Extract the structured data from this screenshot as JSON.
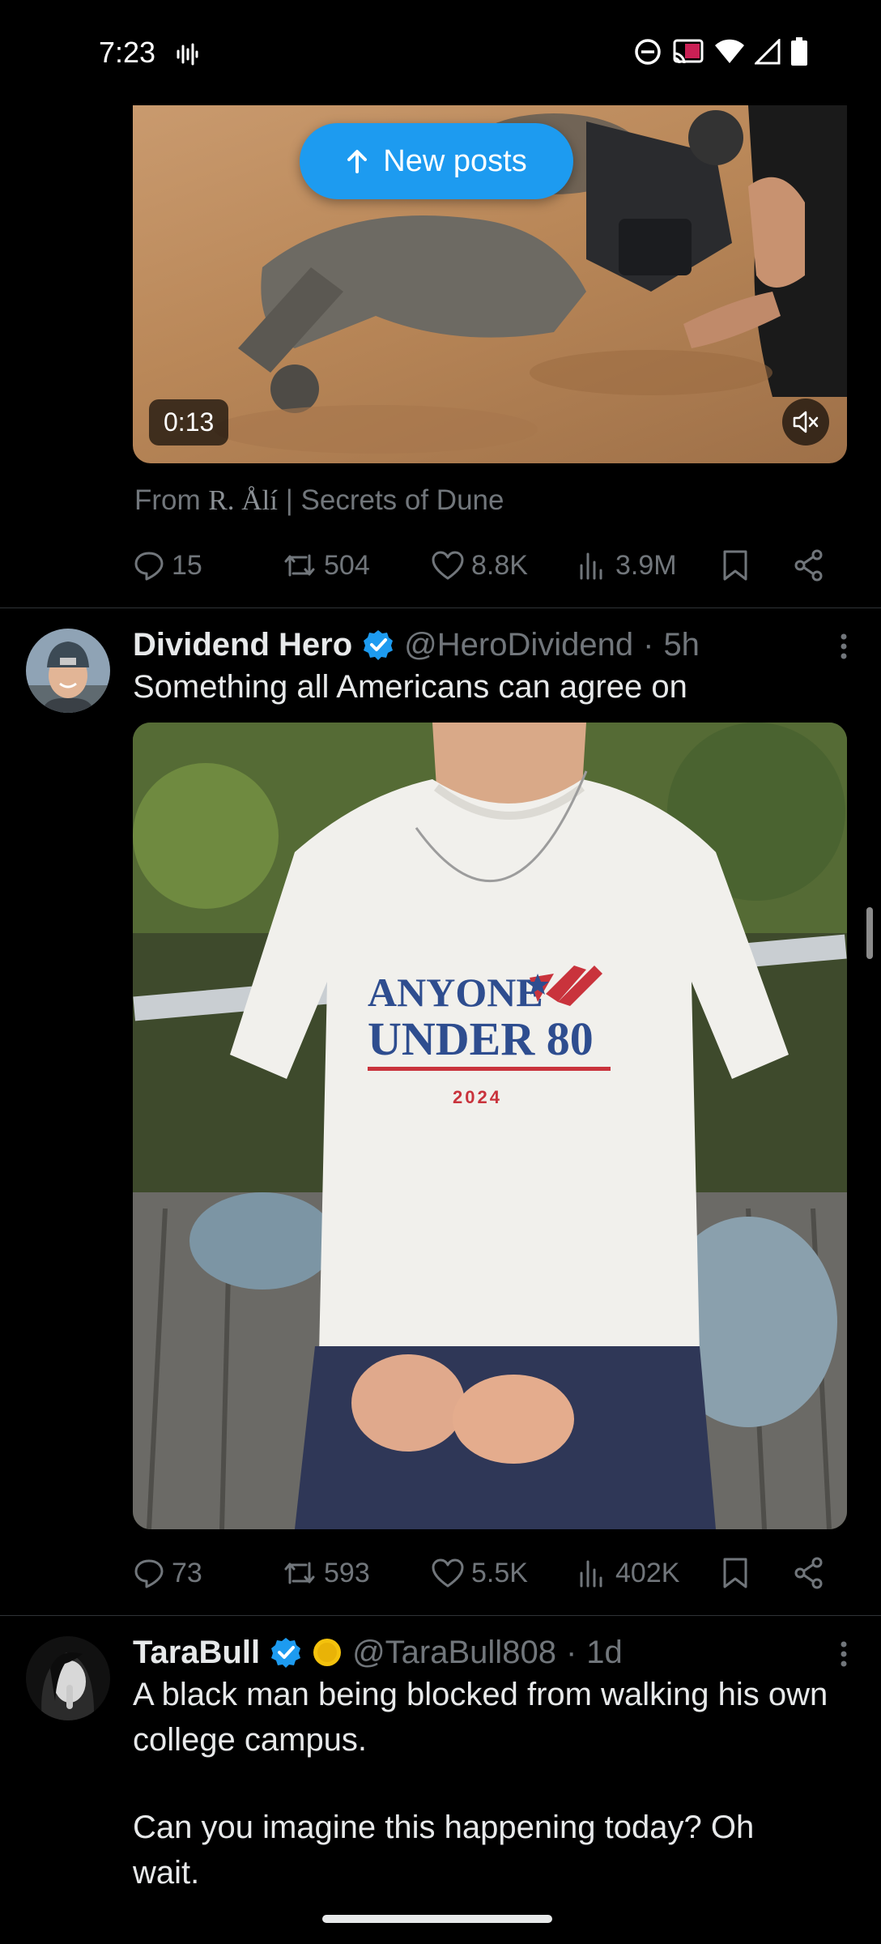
{
  "status_bar": {
    "time": "7:23"
  },
  "new_posts": {
    "label": "New posts"
  },
  "video_post": {
    "duration": "0:13",
    "source_prefix": "From",
    "source_name": "R. Ålí",
    "source_suffix": "| Secrets of Dune",
    "replies": "15",
    "reposts": "504",
    "likes": "8.8K",
    "views": "3.9M"
  },
  "post1": {
    "display_name": "Dividend Hero",
    "handle": "@HeroDividend",
    "separator": "·",
    "time": "5h",
    "text": "Something all Americans can agree on",
    "shirt": {
      "line1": "ANYONE",
      "line2": "UNDER 80",
      "year": "2024"
    },
    "replies": "73",
    "reposts": "593",
    "likes": "5.5K",
    "views": "402K"
  },
  "post2": {
    "display_name": "TaraBull",
    "handle": "@TaraBull808",
    "separator": "·",
    "time": "1d",
    "text_line1": "A black man being blocked from walking his own college campus.",
    "text_line2": "Can you imagine this happening today? Oh wait."
  },
  "colors": {
    "accent": "#1d9bf0",
    "muted": "#71767b",
    "text": "#e7e9ea",
    "background": "#000000",
    "divider": "#2f3336"
  }
}
